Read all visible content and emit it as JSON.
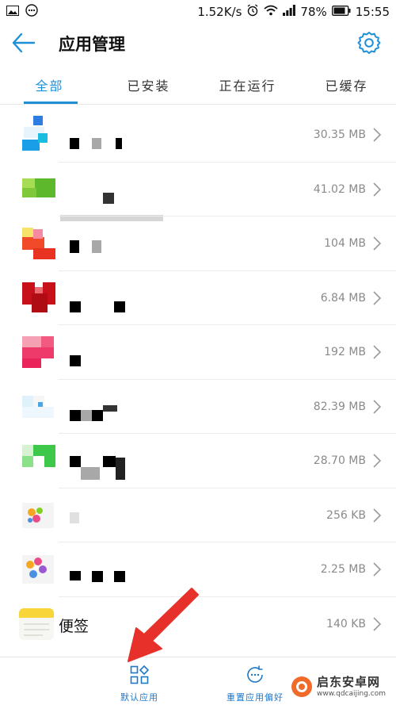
{
  "status_bar": {
    "network_speed": "1.52K/s",
    "battery": "78%",
    "time": "15:55"
  },
  "header": {
    "title": "应用管理",
    "back_icon": "arrow-left-icon",
    "settings_icon": "gear-icon"
  },
  "tabs": [
    {
      "label": "全部",
      "active": true
    },
    {
      "label": "已安装",
      "active": false
    },
    {
      "label": "正在运行",
      "active": false
    },
    {
      "label": "已缓存",
      "active": false
    }
  ],
  "apps": [
    {
      "name": "",
      "size": "30.35 MB"
    },
    {
      "name": "",
      "size": "41.02 MB"
    },
    {
      "name": "",
      "size": "104 MB"
    },
    {
      "name": "",
      "size": "6.84 MB"
    },
    {
      "name": "",
      "size": "192 MB"
    },
    {
      "name": "",
      "size": "82.39 MB"
    },
    {
      "name": "",
      "size": "28.70 MB"
    },
    {
      "name": "",
      "size": "256 KB"
    },
    {
      "name": "",
      "size": "2.25 MB"
    },
    {
      "name": "便签",
      "size": "140 KB"
    }
  ],
  "bottom_bar": {
    "default_apps_label": "默认应用",
    "reset_prefs_label": "重置应用偏好"
  },
  "watermark": {
    "brand": "启东安卓网",
    "url": "www.qdcaijing.com"
  },
  "colors": {
    "accent": "#1e90d8",
    "arrow": "#e8302a"
  }
}
